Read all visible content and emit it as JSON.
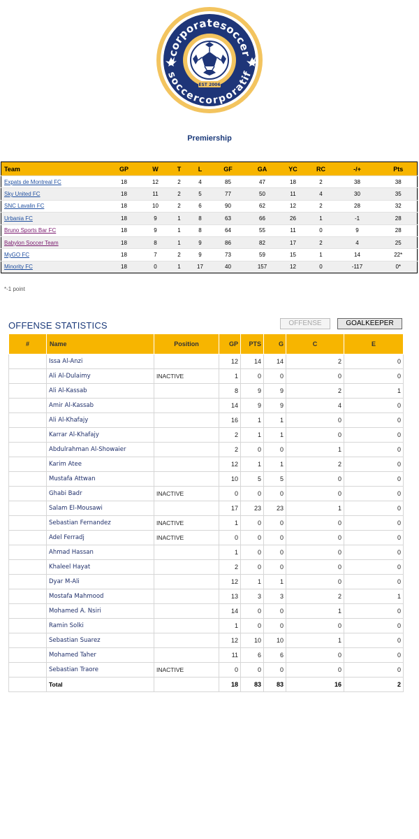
{
  "logo": {
    "top_text": "corporatesoccer",
    "bottom_text": "soccercorporatif",
    "est": "EST 2006"
  },
  "section_title": "Premiership",
  "standings": {
    "headers": [
      "Team",
      "GP",
      "W",
      "T",
      "L",
      "GF",
      "GA",
      "YC",
      "RC",
      "-/+",
      "Pts"
    ],
    "rows": [
      {
        "team": "Expats de Montreal FC",
        "gp": "18",
        "w": "12",
        "t": "2",
        "l": "4",
        "gf": "85",
        "ga": "47",
        "yc": "18",
        "rc": "2",
        "diff": "38",
        "pts": "38",
        "visited": false
      },
      {
        "team": "Sky United FC",
        "gp": "18",
        "w": "11",
        "t": "2",
        "l": "5",
        "gf": "77",
        "ga": "50",
        "yc": "11",
        "rc": "4",
        "diff": "30",
        "pts": "35",
        "visited": false
      },
      {
        "team": "SNC Lavalin FC",
        "gp": "18",
        "w": "10",
        "t": "2",
        "l": "6",
        "gf": "90",
        "ga": "62",
        "yc": "12",
        "rc": "2",
        "diff": "28",
        "pts": "32",
        "visited": false
      },
      {
        "team": "Urbania FC",
        "gp": "18",
        "w": "9",
        "t": "1",
        "l": "8",
        "gf": "63",
        "ga": "66",
        "yc": "26",
        "rc": "1",
        "diff": "-1",
        "pts": "28",
        "visited": false
      },
      {
        "team": "Bruno Sports Bar FC",
        "gp": "18",
        "w": "9",
        "t": "1",
        "l": "8",
        "gf": "64",
        "ga": "55",
        "yc": "11",
        "rc": "0",
        "diff": "9",
        "pts": "28",
        "visited": true
      },
      {
        "team": "Babylon Soccer Team",
        "gp": "18",
        "w": "8",
        "t": "1",
        "l": "9",
        "gf": "86",
        "ga": "82",
        "yc": "17",
        "rc": "2",
        "diff": "4",
        "pts": "25",
        "visited": true
      },
      {
        "team": "MyGO FC",
        "gp": "18",
        "w": "7",
        "t": "2",
        "l": "9",
        "gf": "73",
        "ga": "59",
        "yc": "15",
        "rc": "1",
        "diff": "14",
        "pts": "22*",
        "visited": false
      },
      {
        "team": "Minority FC",
        "gp": "18",
        "w": "0",
        "t": "1",
        "l": "17",
        "gf": "40",
        "ga": "157",
        "yc": "12",
        "rc": "0",
        "diff": "-117",
        "pts": "0*",
        "visited": false
      }
    ]
  },
  "footnote": "*-1 point",
  "offense": {
    "title": "OFFENSE STATISTICS",
    "offense_button": "OFFENSE",
    "goalkeeper_button": "GOALKEEPER",
    "headers": [
      "#",
      "Name",
      "Position",
      "GP",
      "PTS",
      "G",
      "C",
      "E"
    ],
    "rows": [
      {
        "num": "",
        "name": "Issa Al-Anzi",
        "pos": "",
        "gp": "12",
        "pts": "14",
        "g": "14",
        "c": "2",
        "e": "0"
      },
      {
        "num": "",
        "name": "Ali Al-Dulaimy",
        "pos": "INACTIVE",
        "gp": "1",
        "pts": "0",
        "g": "0",
        "c": "0",
        "e": "0"
      },
      {
        "num": "",
        "name": "Ali Al-Kassab",
        "pos": "",
        "gp": "8",
        "pts": "9",
        "g": "9",
        "c": "2",
        "e": "1"
      },
      {
        "num": "",
        "name": "Amir Al-Kassab",
        "pos": "",
        "gp": "14",
        "pts": "9",
        "g": "9",
        "c": "4",
        "e": "0"
      },
      {
        "num": "",
        "name": "Ali Al-Khafajy",
        "pos": "",
        "gp": "16",
        "pts": "1",
        "g": "1",
        "c": "0",
        "e": "0"
      },
      {
        "num": "",
        "name": "Karrar Al-Khafajy",
        "pos": "",
        "gp": "2",
        "pts": "1",
        "g": "1",
        "c": "0",
        "e": "0"
      },
      {
        "num": "",
        "name": "Abdulrahman Al-Showaier",
        "pos": "",
        "gp": "2",
        "pts": "0",
        "g": "0",
        "c": "1",
        "e": "0"
      },
      {
        "num": "",
        "name": "Karim Atee",
        "pos": "",
        "gp": "12",
        "pts": "1",
        "g": "1",
        "c": "2",
        "e": "0"
      },
      {
        "num": "",
        "name": "Mustafa Attwan",
        "pos": "",
        "gp": "10",
        "pts": "5",
        "g": "5",
        "c": "0",
        "e": "0"
      },
      {
        "num": "",
        "name": "Ghabi Badr",
        "pos": "INACTIVE",
        "gp": "0",
        "pts": "0",
        "g": "0",
        "c": "0",
        "e": "0"
      },
      {
        "num": "",
        "name": "Salam El-Mousawi",
        "pos": "",
        "gp": "17",
        "pts": "23",
        "g": "23",
        "c": "1",
        "e": "0"
      },
      {
        "num": "",
        "name": "Sebastian Fernandez",
        "pos": "INACTIVE",
        "gp": "1",
        "pts": "0",
        "g": "0",
        "c": "0",
        "e": "0"
      },
      {
        "num": "",
        "name": "Adel Ferradj",
        "pos": "INACTIVE",
        "gp": "0",
        "pts": "0",
        "g": "0",
        "c": "0",
        "e": "0"
      },
      {
        "num": "",
        "name": "Ahmad Hassan",
        "pos": "",
        "gp": "1",
        "pts": "0",
        "g": "0",
        "c": "0",
        "e": "0"
      },
      {
        "num": "",
        "name": "Khaleel Hayat",
        "pos": "",
        "gp": "2",
        "pts": "0",
        "g": "0",
        "c": "0",
        "e": "0"
      },
      {
        "num": "",
        "name": "Dyar M-Ali",
        "pos": "",
        "gp": "12",
        "pts": "1",
        "g": "1",
        "c": "0",
        "e": "0"
      },
      {
        "num": "",
        "name": "Mostafa Mahmood",
        "pos": "",
        "gp": "13",
        "pts": "3",
        "g": "3",
        "c": "2",
        "e": "1"
      },
      {
        "num": "",
        "name": "Mohamed A. Nsiri",
        "pos": "",
        "gp": "14",
        "pts": "0",
        "g": "0",
        "c": "1",
        "e": "0"
      },
      {
        "num": "",
        "name": "Ramin Solki",
        "pos": "",
        "gp": "1",
        "pts": "0",
        "g": "0",
        "c": "0",
        "e": "0"
      },
      {
        "num": "",
        "name": "Sebastian Suarez",
        "pos": "",
        "gp": "12",
        "pts": "10",
        "g": "10",
        "c": "1",
        "e": "0"
      },
      {
        "num": "",
        "name": "Mohamed Taher",
        "pos": "",
        "gp": "11",
        "pts": "6",
        "g": "6",
        "c": "0",
        "e": "0"
      },
      {
        "num": "",
        "name": "Sebastian Traore",
        "pos": "INACTIVE",
        "gp": "0",
        "pts": "0",
        "g": "0",
        "c": "0",
        "e": "0"
      }
    ],
    "total": {
      "num": "",
      "name": "Total",
      "pos": "",
      "gp": "18",
      "pts": "83",
      "g": "83",
      "c": "16",
      "e": "2"
    }
  },
  "colors": {
    "header_bg": "#f7b500",
    "navy": "#1b3a7a",
    "link": "#1f4fa0",
    "visited_link": "#7a1a6e"
  }
}
